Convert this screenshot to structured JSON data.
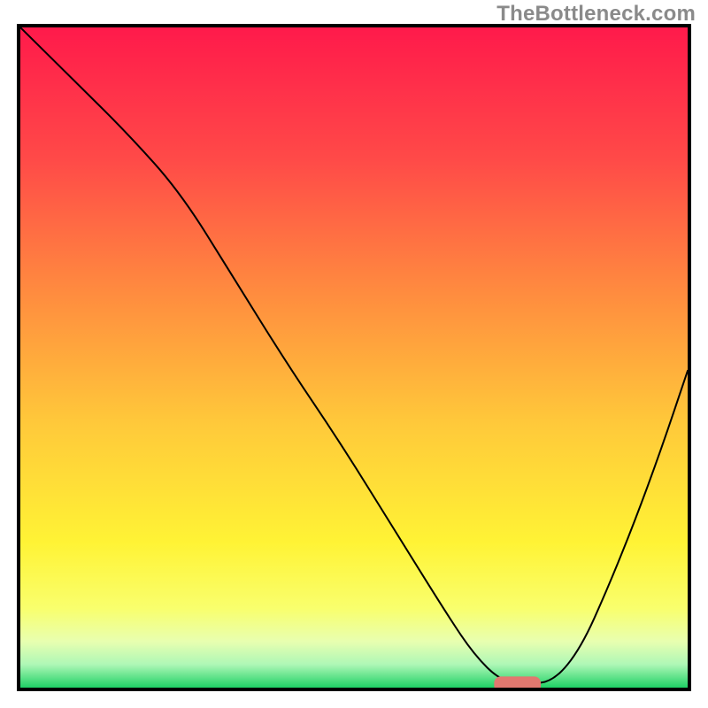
{
  "watermark": "TheBottleneck.com",
  "chart_data": {
    "type": "line",
    "title": "",
    "xlabel": "",
    "ylabel": "",
    "xlim": [
      0,
      100
    ],
    "ylim": [
      0,
      100
    ],
    "grid": false,
    "series": [
      {
        "name": "bottleneck-curve",
        "x": [
          0,
          8,
          16,
          24,
          32,
          40,
          48,
          56,
          64,
          68,
          72,
          76,
          80,
          84,
          88,
          92,
          96,
          100
        ],
        "values": [
          100,
          92,
          84,
          75,
          62,
          49,
          37,
          24,
          11,
          5,
          1,
          0.5,
          1,
          6,
          15,
          25,
          36,
          48
        ]
      }
    ],
    "marker": {
      "x_range": [
        71,
        78
      ],
      "y": 0.5,
      "color": "#e1786f"
    },
    "gradient_stops": [
      {
        "offset": 0.0,
        "color": "#ff1a4b"
      },
      {
        "offset": 0.2,
        "color": "#ff4a48"
      },
      {
        "offset": 0.4,
        "color": "#ff8b3f"
      },
      {
        "offset": 0.6,
        "color": "#ffc93a"
      },
      {
        "offset": 0.78,
        "color": "#fff335"
      },
      {
        "offset": 0.88,
        "color": "#f9ff6d"
      },
      {
        "offset": 0.93,
        "color": "#e8ffb0"
      },
      {
        "offset": 0.965,
        "color": "#aef7b6"
      },
      {
        "offset": 1.0,
        "color": "#1fd165"
      }
    ]
  }
}
